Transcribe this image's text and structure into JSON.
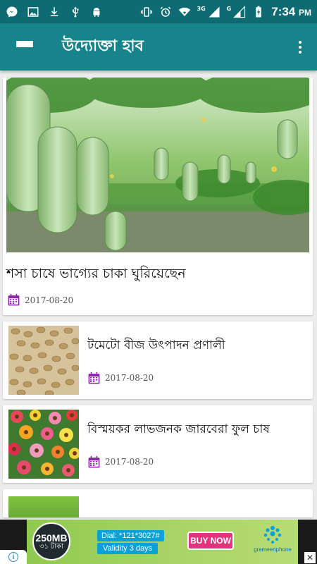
{
  "status_bar": {
    "time": "7:34",
    "ampm": "PM",
    "network_3g": "3G",
    "network_g": "G",
    "icons": [
      "messenger-icon",
      "gallery-icon",
      "download-icon",
      "usb-icon",
      "android-icon",
      "vibrate-icon",
      "alarm-icon",
      "wifi-icon",
      "signal-icon",
      "battery-charging-icon"
    ]
  },
  "app_bar": {
    "title": "উদ্যোক্তা হাব",
    "menu_icon": "hamburger-menu-icon",
    "overflow_icon": "more-vert-icon"
  },
  "featured": {
    "title": "শসা চাষে ভাগ্যের চাকা ঘুরিয়েছেন",
    "date": "2017-08-20"
  },
  "articles": [
    {
      "title": "টমেটো বীজ উৎপাদন প্রণালী",
      "date": "2017-08-20"
    },
    {
      "title": "বিস্ময়কর লাভজনক জারবেরা ফুল চাষ",
      "date": "2017-08-20"
    }
  ],
  "ad": {
    "bubble_mb": "250MB",
    "bubble_price": "৩১ টাকা",
    "dial": "Dial: *121*3027#",
    "validity": "Validity 3 days",
    "buy_label": "BUY NOW",
    "brand": "grameenphone"
  },
  "colors": {
    "status_bar": "#0e6b73",
    "app_bar": "#17848c",
    "calendar_icon": "#8e24aa",
    "background": "#ececec"
  }
}
